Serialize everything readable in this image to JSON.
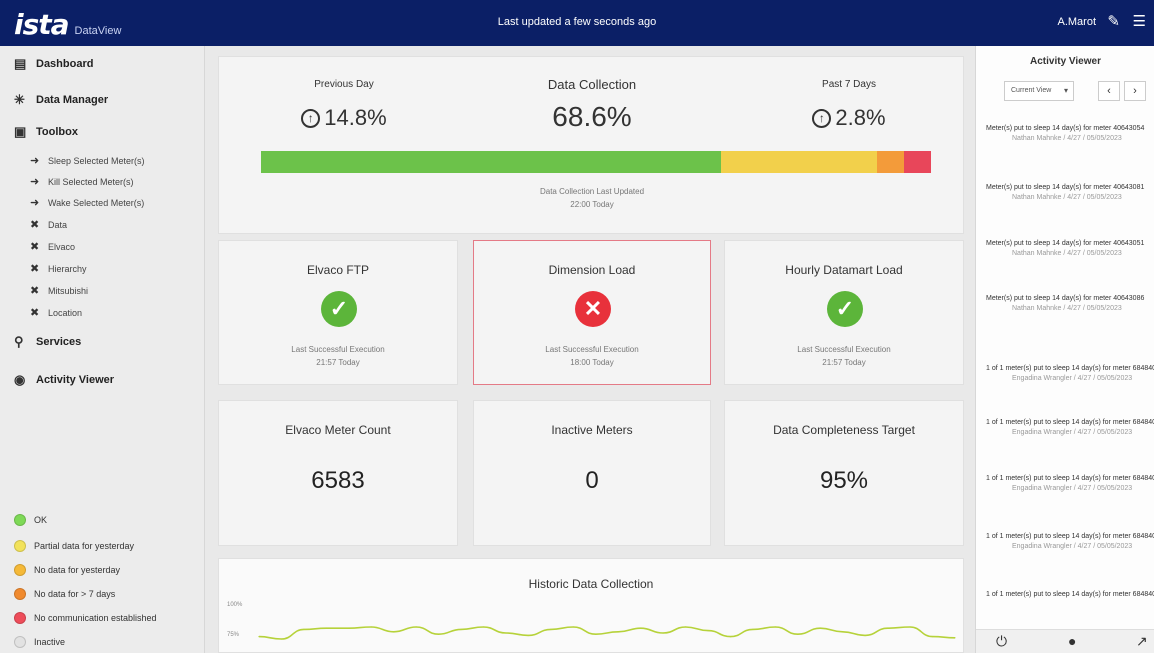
{
  "header": {
    "logo": "ista",
    "app_name": "DataView",
    "last_updated": "Last updated a few seconds ago",
    "user": "A.Marot",
    "icons": [
      "edit-icon",
      "menu-icon"
    ]
  },
  "sidebar": {
    "items": [
      {
        "icon": "dashboard-icon",
        "label": "Dashboard"
      },
      {
        "icon": "data-manager-icon",
        "label": "Data Manager"
      },
      {
        "icon": "toolbox-icon",
        "label": "Toolbox"
      },
      {
        "icon": "services-icon",
        "label": "Services"
      },
      {
        "icon": "activity-icon",
        "label": "Activity Viewer"
      }
    ],
    "toolbox_items": [
      {
        "icon": "arrow-right-icon",
        "label": "Sleep Selected Meter(s)"
      },
      {
        "icon": "arrow-right-icon",
        "label": "Kill Selected Meter(s)"
      },
      {
        "icon": "arrow-right-icon",
        "label": "Wake Selected Meter(s)"
      },
      {
        "icon": "tools-icon",
        "label": "Data"
      },
      {
        "icon": "tools-icon",
        "label": "Elvaco"
      },
      {
        "icon": "tools-icon",
        "label": "Hierarchy"
      },
      {
        "icon": "tools-icon",
        "label": "Mitsubishi"
      },
      {
        "icon": "tools-icon",
        "label": "Location"
      }
    ],
    "legend": [
      {
        "label": "OK",
        "color": "#7ed957"
      },
      {
        "label": "Partial data for yesterday",
        "color": "#f2e25b"
      },
      {
        "label": "No data for yesterday",
        "color": "#f5b938"
      },
      {
        "label": "No data for > 7 days",
        "color": "#f08a2e"
      },
      {
        "label": "No communication established",
        "color": "#ee4d5a"
      },
      {
        "label": "Inactive",
        "color": "#e2e2e2"
      }
    ]
  },
  "kpi": {
    "previous_day": {
      "label": "Previous Day",
      "value": "14.8%"
    },
    "data_collection": {
      "label": "Data Collection",
      "value": "68.6%"
    },
    "past_7_days": {
      "label": "Past 7 Days",
      "value": "2.8%"
    },
    "progress_segments": [
      {
        "fraction": 0.686,
        "color": "#6cc24a"
      },
      {
        "fraction": 0.234,
        "color": "#f2d04b"
      },
      {
        "fraction": 0.04,
        "color": "#f39b3a"
      },
      {
        "fraction": 0.04,
        "color": "#e8465a"
      }
    ],
    "last_updated_label": "Data Collection Last Updated",
    "last_updated_value": "22:00 Today"
  },
  "status_cards": [
    {
      "title": "Elvaco FTP",
      "status": "success",
      "icon": "check-circle-icon",
      "color": "#5cb53a",
      "caption": "Last Successful Execution",
      "time": "21:57 Today"
    },
    {
      "title": "Dimension Load",
      "status": "error",
      "icon": "x-circle-icon",
      "color": "#e8313b",
      "caption": "Last Successful Execution",
      "time": "18:00 Today"
    },
    {
      "title": "Hourly Datamart Load",
      "status": "success",
      "icon": "check-circle-icon",
      "color": "#5cb53a",
      "caption": "Last Successful Execution",
      "time": "21:57 Today"
    }
  ],
  "stat_cards": [
    {
      "title": "Elvaco Meter Count",
      "value": "6583"
    },
    {
      "title": "Inactive Meters",
      "value": "0"
    },
    {
      "title": "Data Completeness Target",
      "value": "95%"
    }
  ],
  "historic": {
    "title": "Historic Data Collection",
    "y_ticks": [
      "100%",
      "75%"
    ]
  },
  "chart_data": {
    "type": "line",
    "title": "Historic Data Collection",
    "xlabel": "",
    "ylabel": "",
    "y_ticks": [
      "100%",
      "75%"
    ],
    "values": [
      72,
      70,
      78,
      79,
      79,
      80,
      76,
      80,
      74,
      78,
      80,
      75,
      73,
      78,
      80,
      74,
      76,
      79,
      75,
      80,
      77,
      72,
      78,
      80,
      74,
      79,
      76,
      73,
      79,
      80,
      72,
      71
    ],
    "ylim": [
      60,
      105
    ],
    "color": "#b6d23a"
  },
  "activity": {
    "title": "Activity Viewer",
    "filter": "Current View",
    "items": [
      {
        "text": "Meter(s) put to sleep 14 day(s) for meter 40643054",
        "by": "Nathan Mahnke / 4/27 / 05/05/2023"
      },
      {
        "text": "Meter(s) put to sleep 14 day(s) for meter 40643081",
        "by": "Nathan Mahnke / 4/27 / 05/05/2023"
      },
      {
        "text": "Meter(s) put to sleep 14 day(s) for meter 40643051",
        "by": "Nathan Mahnke / 4/27 / 05/05/2023"
      },
      {
        "text": "Meter(s) put to sleep 14 day(s) for meter 40643086",
        "by": "Nathan Mahnke / 4/27 / 05/05/2023"
      },
      {
        "text": "1 of 1 meter(s) put to sleep 14 day(s) for meter 68484008",
        "by": "Engadina Wrangler / 4/27 / 05/05/2023"
      },
      {
        "text": "1 of 1 meter(s) put to sleep 14 day(s) for meter 68484006",
        "by": "Engadina Wrangler / 4/27 / 05/05/2023"
      },
      {
        "text": "1 of 1 meter(s) put to sleep 14 day(s) for meter 68484003",
        "by": "Engadina Wrangler / 4/27 / 05/05/2023"
      },
      {
        "text": "1 of 1 meter(s) put to sleep 14 day(s) for meter 68484023",
        "by": "Engadina Wrangler / 4/27 / 05/05/2023"
      },
      {
        "text": "1 of 1 meter(s) put to sleep 14 day(s) for meter 68484004",
        "by": ""
      }
    ],
    "footer_icons": [
      "power-icon",
      "user-icon",
      "link-icon"
    ]
  }
}
